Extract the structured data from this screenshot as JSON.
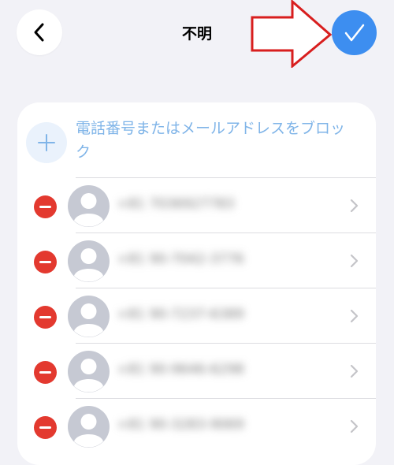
{
  "header": {
    "title": "不明"
  },
  "block_section": {
    "add_label": "電話番号またはメールアドレスをブロック"
  },
  "blocked_list": [
    {
      "number": "+81 7036927783"
    },
    {
      "number": "+81 90-7042-3776"
    },
    {
      "number": "+81 90-7237-6389"
    },
    {
      "number": "+81 90-9646-6298"
    },
    {
      "number": "+81 90-3283-9069"
    }
  ],
  "colors": {
    "accent": "#3d8ef0",
    "delete": "#e3392f",
    "annotation_arrow": "#d81e1e"
  },
  "icons": {
    "back": "chevron-left-icon",
    "done": "checkmark-icon",
    "add": "plus-icon",
    "remove": "minus-circle-icon",
    "avatar": "person-avatar-icon",
    "disclosure": "chevron-right-icon"
  }
}
